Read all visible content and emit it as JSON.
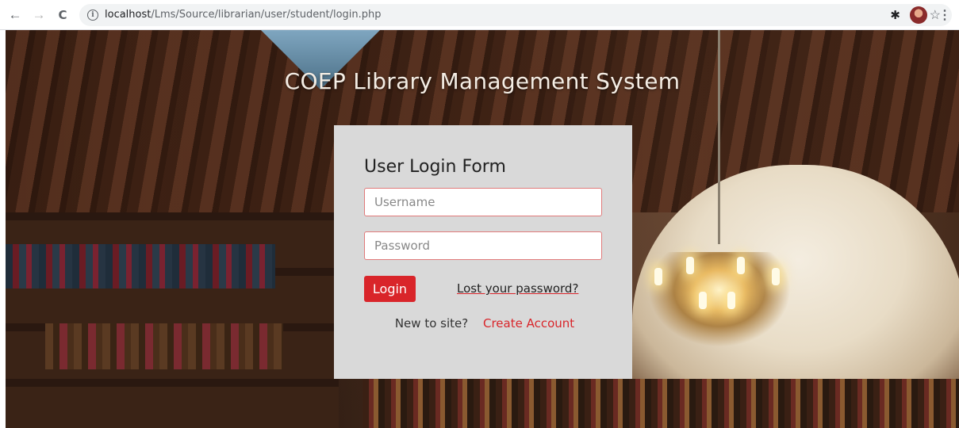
{
  "browser": {
    "back_icon": "←",
    "forward_icon": "→",
    "reload_icon": "C",
    "url_host": "localhost",
    "url_path": "/Lms/Source/librarian/user/student/login.php",
    "star_icon": "☆",
    "extensions_icon": "✱",
    "menu_icon": "⋮"
  },
  "page": {
    "site_title": "COEP Library Management System"
  },
  "login_form": {
    "title": "User Login Form",
    "username_placeholder": "Username",
    "password_placeholder": "Password",
    "login_label": "Login",
    "lost_password_label": "Lost your password?",
    "new_to_site": "New to site?",
    "create_account_label": "Create Account"
  },
  "colors": {
    "accent": "#d9252a",
    "card_background": "#d9d9d9"
  }
}
